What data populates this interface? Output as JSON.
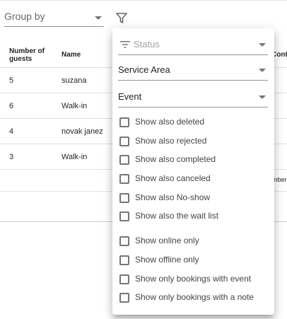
{
  "toolbar": {
    "group_by_label": "Group by"
  },
  "table": {
    "headers": {
      "guests": "Number of guests",
      "name": "Name",
      "contact_partial": "Cont"
    },
    "rows": [
      {
        "guests": "5",
        "name": "suzana"
      },
      {
        "guests": "6",
        "name": "Walk-in"
      },
      {
        "guests": "4",
        "name": "novak janez"
      },
      {
        "guests": "3",
        "name": "Walk-in"
      }
    ],
    "footer_trailing_text": "mber"
  },
  "filter_panel": {
    "status_placeholder": "Status",
    "service_area_label": "Service Area",
    "event_label": "Event",
    "options": [
      {
        "label": "Show also deleted",
        "checked": false
      },
      {
        "label": "Show also rejected",
        "checked": false
      },
      {
        "label": "Show also completed",
        "checked": false
      },
      {
        "label": "Show also canceled",
        "checked": false
      },
      {
        "label": "Show also No-show",
        "checked": false
      },
      {
        "label": "Show also the wait list",
        "checked": false
      },
      {
        "label": "Show online only",
        "checked": false
      },
      {
        "label": "Show offline only",
        "checked": false
      },
      {
        "label": "Show only bookings with event",
        "checked": false
      },
      {
        "label": "Show only bookings with a note",
        "checked": false
      }
    ]
  }
}
